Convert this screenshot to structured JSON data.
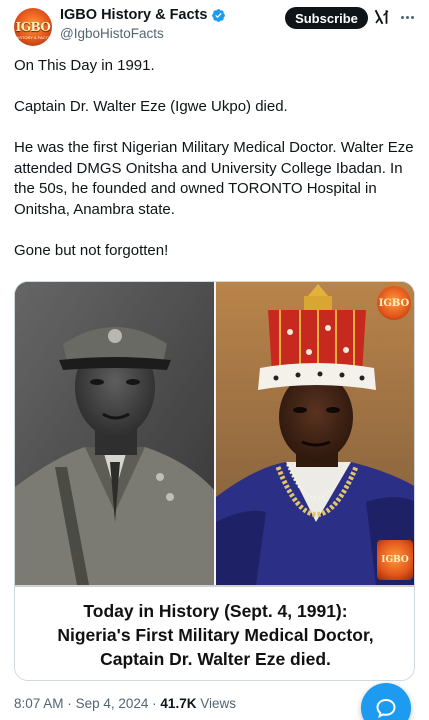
{
  "author": {
    "display_name": "IGBO History & Facts",
    "handle": "@IgboHistoFacts",
    "avatar_text": "IGBO",
    "avatar_subtext": "HISTORY & FACTS",
    "verified": true
  },
  "header": {
    "subscribe_label": "Subscribe",
    "grok_icon": "grok-icon",
    "more_icon": "more-icon"
  },
  "tweet": {
    "paragraphs": [
      "On This Day in 1991.",
      "Captain Dr. Walter Eze (Igwe Ukpo) died.",
      "He was the first Nigerian Military Medical Doctor. Walter Eze attended DMGS Onitsha and University College Ibadan. In the 50s, he founded and owned TORONTO Hospital in Onitsha, Anambra state.",
      "Gone but not forgotten!"
    ]
  },
  "media": {
    "left_photo_desc_icon": "military-portrait",
    "right_photo_desc_icon": "crowned-portrait",
    "watermark_text": "IGBO",
    "caption_lines": [
      "Today in History (Sept. 4, 1991):",
      "Nigeria's First Military Medical Doctor,",
      "Captain Dr. Walter Eze died."
    ]
  },
  "meta": {
    "time": "8:07 AM",
    "separator": "·",
    "date": "Sep 4, 2024",
    "views_count": "41.7K",
    "views_label": "Views"
  },
  "colors": {
    "accent": "#1d9bf0",
    "text_primary": "#0f1419",
    "text_secondary": "#536471",
    "border": "#cfd9de"
  }
}
